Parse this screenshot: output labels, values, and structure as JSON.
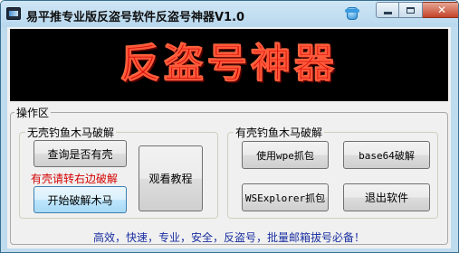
{
  "window": {
    "title": "易平推专业版反盗号软件反盗号神器V1.0",
    "close_glyph": "✕"
  },
  "banner": {
    "text": "反盗号神器"
  },
  "operation_group": {
    "label": "操作区"
  },
  "left_group": {
    "label": "无壳钓鱼木马破解",
    "check_shell_button": "查询是否有壳",
    "shell_warning": "有壳请转右边破解",
    "start_crack_button": "开始破解木马",
    "tutorial_button": "观看教程"
  },
  "right_group": {
    "label": "有壳钓鱼木马破解",
    "wpe_button": "使用wpe抓包",
    "base64_button": "base64破解",
    "wsexplorer_button": "WSExplorer抓包",
    "exit_button": "退出软件"
  },
  "footer": {
    "slogan": "高效，快速，专业，安全，反盗号，批量邮箱拔号必备！"
  },
  "colors": {
    "title_bar": "#bfdbee",
    "banner_background": "#000000",
    "banner_text": "#d10000",
    "warning_text": "#d40000",
    "footer_text": "#1a2fa0"
  },
  "icons": [
    "app-icon",
    "skin-icon",
    "minimize-icon",
    "maximize-icon",
    "close-icon"
  ]
}
